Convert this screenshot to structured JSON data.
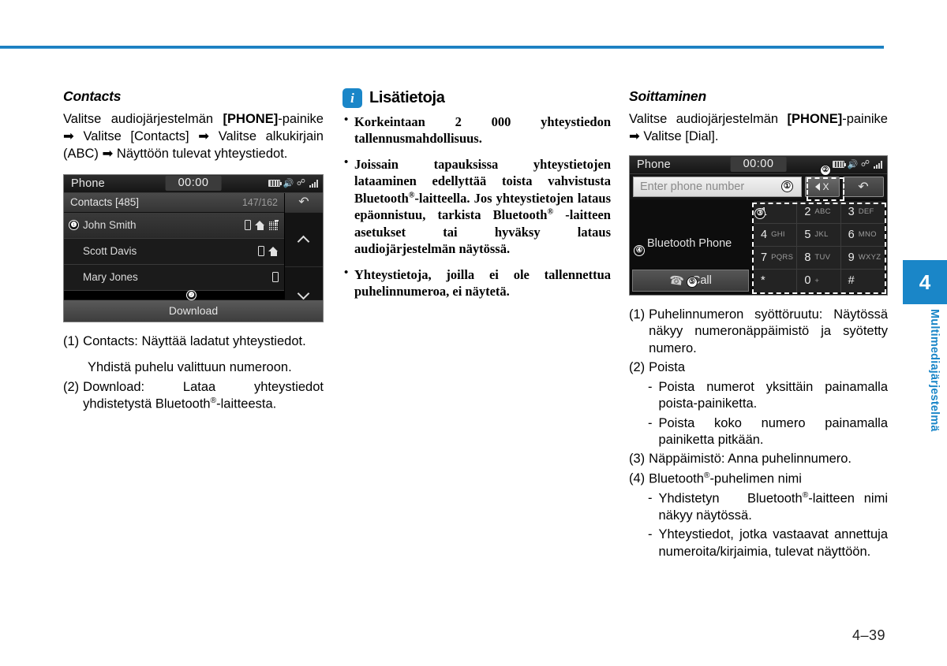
{
  "page": {
    "number": "4–39",
    "chapter_number": "4",
    "chapter_label": "Multimediajärjestelmä"
  },
  "left_column": {
    "title": "Contacts",
    "intro_parts": {
      "a": "Valitse audiojärjestelmän ",
      "b": "[PHONE]",
      "c": "-painike ➡ Valitse [Contacts] ➡ Valitse alkukirjain (ABC) ➡ Näyttöön tulevat yhteystiedot."
    },
    "contacts_screen": {
      "title": "Phone",
      "clock": "00:00",
      "status_icons": [
        "battery-icon",
        "mute-icon",
        "bluetooth-signal-icon"
      ],
      "list_header": {
        "label": "Contacts [485]",
        "count": "147/162"
      },
      "rows": [
        {
          "name": "John Smith",
          "icons": [
            "mobile-icon",
            "home-icon",
            "office-icon"
          ],
          "selected": true,
          "callout": "❶"
        },
        {
          "name": "Scott Davis",
          "icons": [
            "mobile-icon",
            "home-icon"
          ],
          "selected": false,
          "callout": ""
        },
        {
          "name": "Mary Jones",
          "icons": [
            "mobile-icon"
          ],
          "selected": false,
          "callout": ""
        }
      ],
      "download_label": "Download",
      "download_callout": "❷",
      "side_buttons": [
        "return-icon",
        "scroll-up-icon",
        "scroll-down-icon"
      ]
    },
    "notes": [
      {
        "num": "(1)",
        "text": "Contacts: Näyttää ladatut yhteystiedot."
      },
      {
        "num": "",
        "text": "Yhdistä puhelu valittuun numeroon.",
        "indented": true
      },
      {
        "num": "(2)",
        "text": "Download: Lataa yhteystiedot yhdistetystä Bluetooth®-laitteesta."
      }
    ]
  },
  "middle_column": {
    "info_icon": "i",
    "info_title": "Lisätietoja",
    "bullets": [
      "Korkeintaan 2 000 yhteystiedon tallennusmahdollisuus.",
      "Joissain tapauksissa yhteystietojen lataaminen edellyttää toista vahvistusta Bluetooth®-laitteella. Jos yhteystietojen lataus epäonnistuu, tarkista Bluetooth® -laitteen asetukset tai hyväksy lataus audiojärjestelmän näytössä.",
      "Yhteystietoja, joilla ei ole tallennettua puhelinnumeroa, ei näytetä."
    ]
  },
  "right_column": {
    "title": "Soittaminen",
    "intro_parts": {
      "a": "Valitse audiojärjestelmän ",
      "b": "[PHONE]",
      "c": "-painike ➡ Valitse [Dial]."
    },
    "dial_screen": {
      "title": "Phone",
      "clock": "00:00",
      "status_icons": [
        "battery-icon",
        "mute-icon",
        "bluetooth-signal-icon"
      ],
      "input_placeholder": "Enter phone number",
      "input_callout": "①",
      "delete_label": "X",
      "delete_callout": "②",
      "back_icon": "return-icon",
      "keypad_callout": "③",
      "bt_name_callout": "④",
      "bt_name": "Bluetooth Phone",
      "call_callout": "⑤",
      "call_label": "Call",
      "keys": [
        {
          "digit": "1",
          "letters": ""
        },
        {
          "digit": "2",
          "letters": "ABC"
        },
        {
          "digit": "3",
          "letters": "DEF"
        },
        {
          "digit": "4",
          "letters": "GHI"
        },
        {
          "digit": "5",
          "letters": "JKL"
        },
        {
          "digit": "6",
          "letters": "MNO"
        },
        {
          "digit": "7",
          "letters": "PQRS"
        },
        {
          "digit": "8",
          "letters": "TUV"
        },
        {
          "digit": "9",
          "letters": "WXYZ"
        },
        {
          "digit": "*",
          "letters": ""
        },
        {
          "digit": "0",
          "letters": "+"
        },
        {
          "digit": "#",
          "letters": ""
        }
      ]
    },
    "notes": [
      {
        "num": "(1)",
        "text": "Puhelinnumeron syöttöruutu: Näytössä näkyy numeronäppäimistö ja syötetty numero."
      },
      {
        "num": "(2)",
        "text": "Poista"
      },
      {
        "num": "-",
        "text": "Poista numerot yksittäin painamalla poista-painiketta.",
        "dash": true
      },
      {
        "num": "-",
        "text": "Poista koko numero painamalla painiketta pitkään.",
        "dash": true
      },
      {
        "num": "(3)",
        "text": "Näppäimistö: Anna puhelinnumero."
      },
      {
        "num": "(4)",
        "text": "Bluetooth®-puhelimen nimi"
      },
      {
        "num": "-",
        "text": "Yhdistetyn Bluetooth®-laitteen nimi näkyy näytössä.",
        "dash": true
      },
      {
        "num": "-",
        "text": "Yhteystiedot, jotka vastaavat annettuja numeroita/kirjaimia, tulevat näyttöön.",
        "dash": true
      }
    ]
  },
  "colors": {
    "accent": "#1a86c8",
    "rule": "#1a7fc1",
    "device_bg": "#000000"
  }
}
